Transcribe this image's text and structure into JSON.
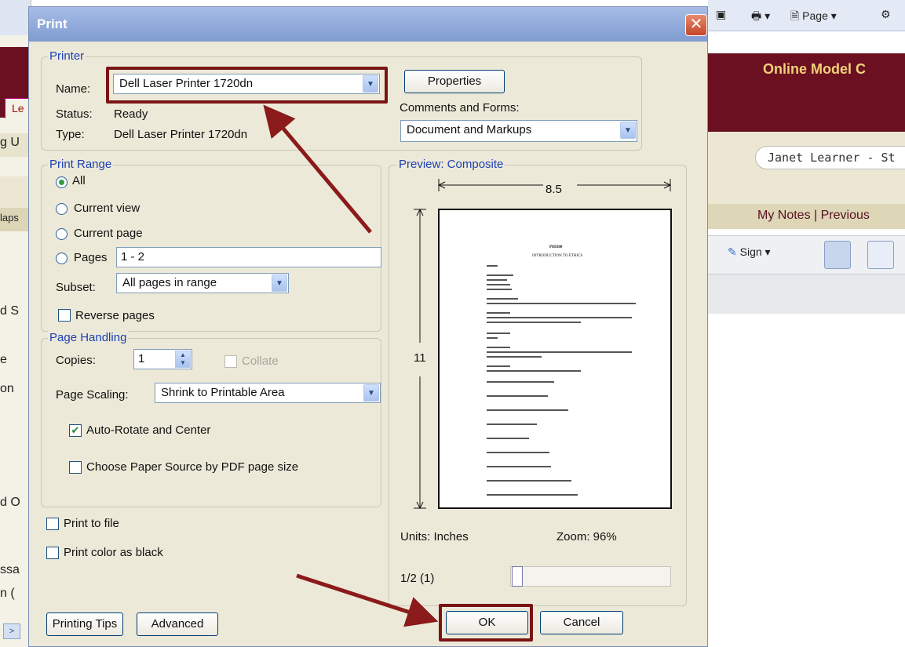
{
  "window": {
    "title": "Print"
  },
  "background": {
    "left_fragments": [
      "Le",
      "g U",
      "laps",
      "d S",
      "e",
      "on",
      "d O",
      "ssa",
      "n (",
      ">"
    ],
    "top_toolbar": {
      "page_menu": "Page"
    },
    "site_title": "Online Model C",
    "user_pill": "Janet Learner - St",
    "notes_links": "My Notes | Previous",
    "sign_button": "Sign"
  },
  "printer": {
    "legend": "Printer",
    "name_label": "Name:",
    "name_value": "Dell Laser Printer 1720dn",
    "status_label": "Status:",
    "status_value": "Ready",
    "type_label": "Type:",
    "type_value": "Dell Laser Printer 1720dn",
    "properties_button": "Properties",
    "comments_label": "Comments and Forms:",
    "comments_value": "Document and Markups"
  },
  "print_range": {
    "legend": "Print Range",
    "all": "All",
    "current_view": "Current view",
    "current_page": "Current page",
    "pages": "Pages",
    "pages_value": "1 - 2",
    "subset_label": "Subset:",
    "subset_value": "All pages in range",
    "reverse_pages": "Reverse pages"
  },
  "page_handling": {
    "legend": "Page Handling",
    "copies_label": "Copies:",
    "copies_value": "1",
    "collate": "Collate",
    "scaling_label": "Page Scaling:",
    "scaling_value": "Shrink to Printable Area",
    "auto_rotate": "Auto-Rotate and Center",
    "paper_source": "Choose Paper Source by PDF page size"
  },
  "options": {
    "print_to_file": "Print to file",
    "print_color_black": "Print color as black"
  },
  "preview": {
    "legend": "Preview: Composite",
    "width": "8.5",
    "height": "11",
    "units": "Units: Inches",
    "zoom": "Zoom:  96%",
    "page_counter": "1/2 (1)",
    "doc_heading": "PHI300",
    "doc_subtitle": "INTRODUCTION TO ETHICS"
  },
  "buttons": {
    "printing_tips": "Printing Tips",
    "advanced": "Advanced",
    "ok": "OK",
    "cancel": "Cancel"
  }
}
